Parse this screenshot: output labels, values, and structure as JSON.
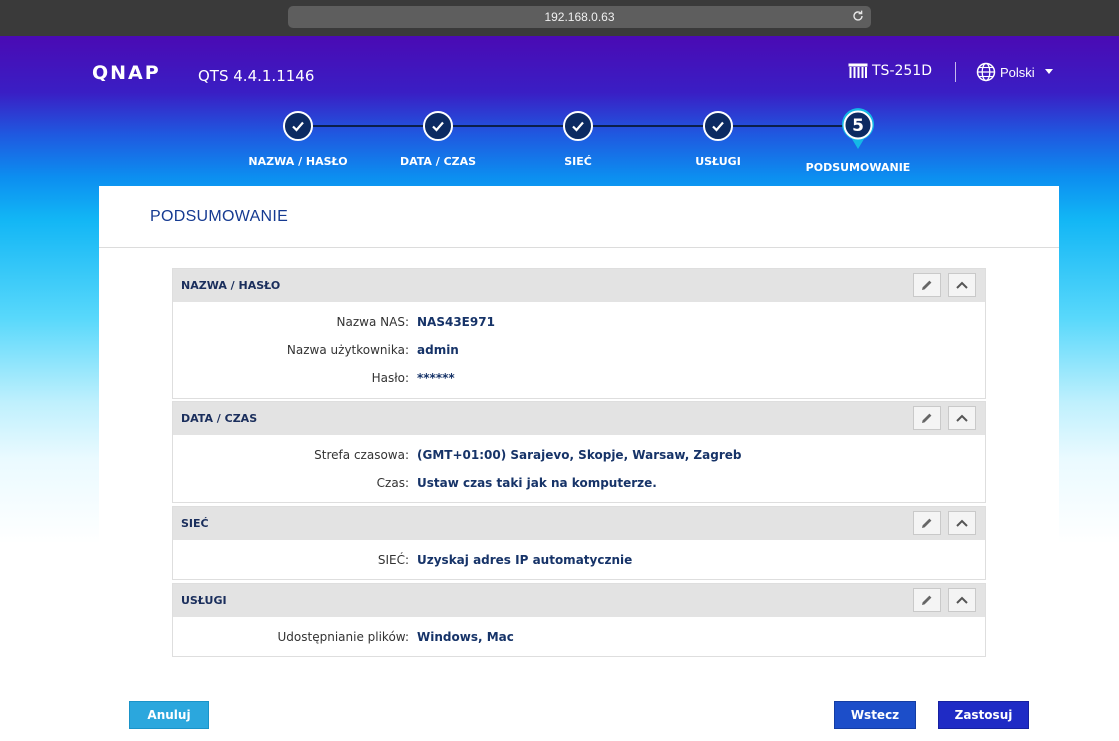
{
  "browser": {
    "url": "192.168.0.63"
  },
  "header": {
    "brand": "QNAP",
    "version": "QTS 4.4.1.1146",
    "model": "TS-251D",
    "language": "Polski"
  },
  "steps": [
    {
      "label": "NAZWA / HASŁO",
      "state": "done"
    },
    {
      "label": "DATA / CZAS",
      "state": "done"
    },
    {
      "label": "SIEĆ",
      "state": "done"
    },
    {
      "label": "USŁUGI",
      "state": "done"
    },
    {
      "label": "PODSUMOWANIE",
      "state": "active",
      "number": "5"
    }
  ],
  "summary": {
    "title": "PODSUMOWANIE",
    "sections": [
      {
        "title": "NAZWA / HASŁO",
        "rows": [
          {
            "label": "Nazwa NAS:",
            "value": "NAS43E971"
          },
          {
            "label": "Nazwa użytkownika:",
            "value": "admin"
          },
          {
            "label": "Hasło:",
            "value": "******"
          }
        ]
      },
      {
        "title": "DATA / CZAS",
        "rows": [
          {
            "label": "Strefa czasowa:",
            "value": "(GMT+01:00) Sarajevo, Skopje, Warsaw, Zagreb"
          },
          {
            "label": "Czas:",
            "value": "Ustaw czas taki jak na komputerze."
          }
        ]
      },
      {
        "title": "SIEĆ",
        "rows": [
          {
            "label": "SIEĆ:",
            "value": "Uzyskaj adres IP automatycznie"
          }
        ]
      },
      {
        "title": "USŁUGI",
        "rows": [
          {
            "label": "Udostępnianie plików:",
            "value": "Windows, Mac"
          }
        ]
      }
    ]
  },
  "footer": {
    "cancel_label": "Anuluj",
    "back_label": "Wstecz",
    "apply_label": "Zastosuj"
  },
  "icons": {
    "reload": "reload-icon",
    "model": "nas-device-icon",
    "language": "globe-icon",
    "edit": "pencil-icon",
    "collapse": "chevron-up-icon",
    "done": "check-icon"
  },
  "colors": {
    "step_circle": "#0c2a62",
    "active_step": "#14b9e6",
    "title_blue": "#153a91",
    "value_blue": "#163368",
    "cancel_button": "#2ba7dd",
    "back_button": "#1c4ec9",
    "apply_button": "#1f2bc5"
  }
}
